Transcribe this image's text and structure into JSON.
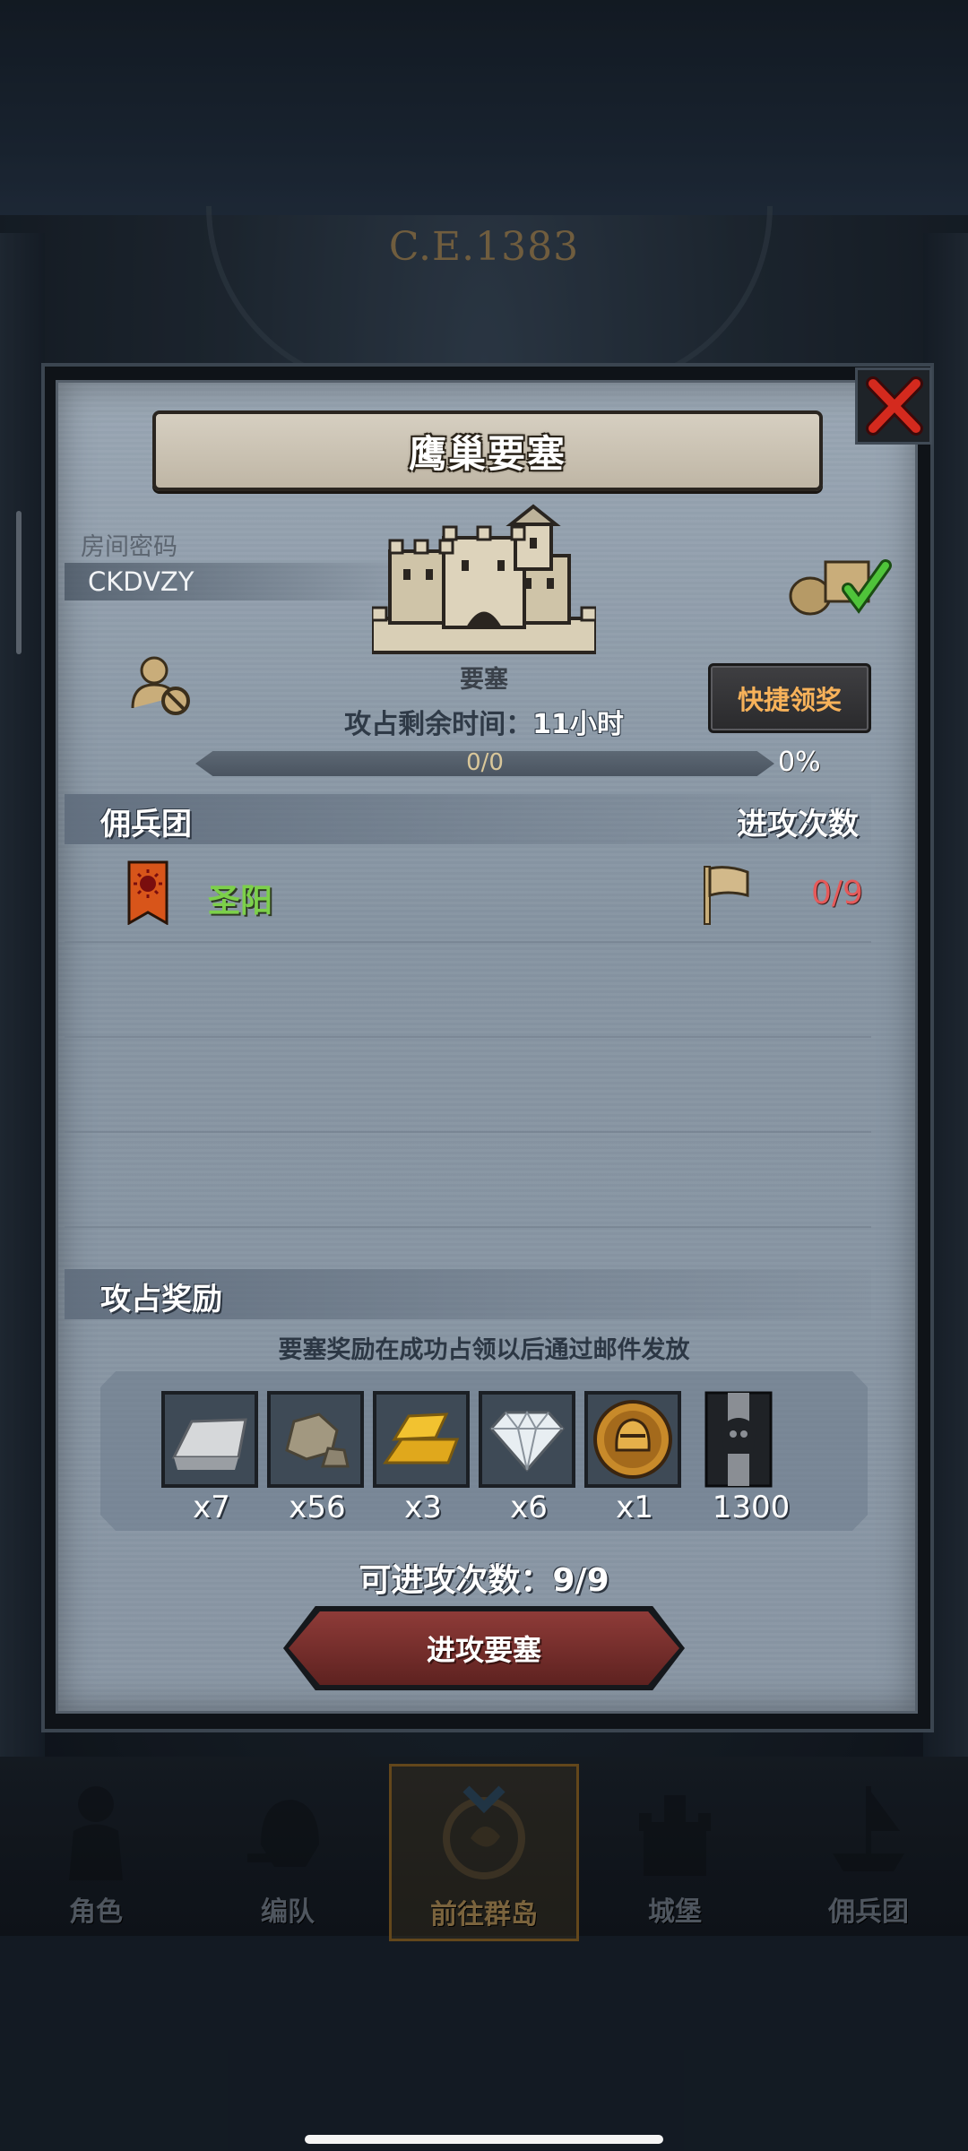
{
  "background": {
    "era_label": "C.E.1383"
  },
  "modal": {
    "title": "鹰巢要塞",
    "room": {
      "label": "房间密码",
      "code": "CKDVZY"
    },
    "fortress_label": "要塞",
    "quick_claim_label": "快捷领奖",
    "timer": {
      "label": "攻占剩余时间：",
      "value": "11小时"
    },
    "progress": {
      "text": "0/0",
      "percent_label": "0%",
      "fraction": 0
    },
    "mercenary_section": {
      "title": "佣兵团",
      "attacks_header": "进攻次数",
      "rows": [
        {
          "name": "圣阳",
          "attacks": "0/9"
        }
      ]
    },
    "reward_section": {
      "title": "攻占奖励",
      "note": "要塞奖励在成功占领以后通过邮件发放",
      "items": [
        {
          "icon": "silver-ingot-icon",
          "qty": "x7"
        },
        {
          "icon": "stone-ore-icon",
          "qty": "x56"
        },
        {
          "icon": "gold-bars-icon",
          "qty": "x3"
        },
        {
          "icon": "diamond-icon",
          "qty": "x6"
        },
        {
          "icon": "knight-helmet-coin-icon",
          "qty": "x1"
        },
        {
          "icon": "war-banner-icon",
          "qty": "1300"
        }
      ]
    },
    "attempts": "可进攻次数：9/9",
    "attack_button_label": "进攻要塞"
  },
  "bottom_nav": [
    {
      "label": "角色",
      "icon": "knight-character-icon",
      "active": false
    },
    {
      "label": "编队",
      "icon": "formation-helmet-icon",
      "active": false
    },
    {
      "label": "前往群岛",
      "icon": "islands-compass-icon",
      "active": true
    },
    {
      "label": "城堡",
      "icon": "castle-icon",
      "active": false
    },
    {
      "label": "佣兵团",
      "icon": "mercenary-ship-icon",
      "active": false
    }
  ],
  "colors": {
    "accent_gold": "#f7b25a",
    "merc_name_green": "#7cd04a",
    "attack_count_red": "#e65a5a",
    "attack_button_red": "#8e3b38"
  }
}
